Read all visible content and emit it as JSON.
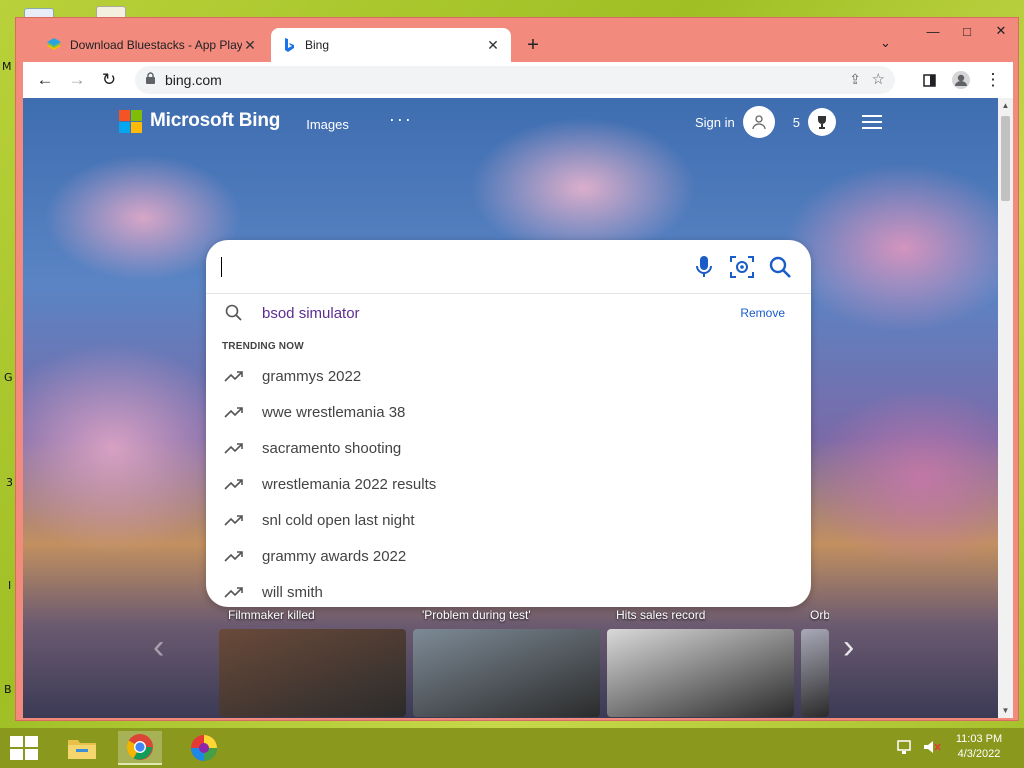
{
  "desktop": {
    "letters": [
      "M",
      "G",
      "3",
      "I",
      "B"
    ]
  },
  "browser": {
    "tabs": [
      {
        "title": "Download Bluestacks - App Player",
        "active": false
      },
      {
        "title": "Bing",
        "active": true
      }
    ],
    "new_tab_symbol": "+",
    "window_controls": {
      "minimize": "—",
      "maximize": "□",
      "close": "✕"
    },
    "address": "bing.com"
  },
  "bing": {
    "brand": "Microsoft Bing",
    "nav_images": "Images",
    "nav_more": "···",
    "sign_in": "Sign in",
    "rewards_count": "5",
    "logo_colors": [
      "#f35325",
      "#81bc06",
      "#05a6f0",
      "#ffba08"
    ],
    "search": {
      "value": "",
      "placeholder": ""
    },
    "history": {
      "text": "bsod simulator",
      "remove": "Remove"
    },
    "trending_header": "TRENDING NOW",
    "trending": [
      "grammys 2022",
      "wwe wrestlemania 38",
      "sacramento shooting",
      "wrestlemania 2022 results",
      "snl cold open last night",
      "grammy awards 2022",
      "will smith"
    ],
    "news": [
      {
        "label": "Filmmaker killed",
        "color": "#6a4a3a"
      },
      {
        "label": "'Problem during test'",
        "color": "#7d8a96"
      },
      {
        "label": "Hits sales record",
        "color": "#d9d9d9"
      },
      {
        "label": "Orb",
        "color": "#a9a9b8"
      }
    ],
    "accent_color": "#1a5cc8",
    "history_color": "#5c2d91"
  },
  "taskbar": {
    "time": "11:03 PM",
    "date": "4/3/2022"
  }
}
